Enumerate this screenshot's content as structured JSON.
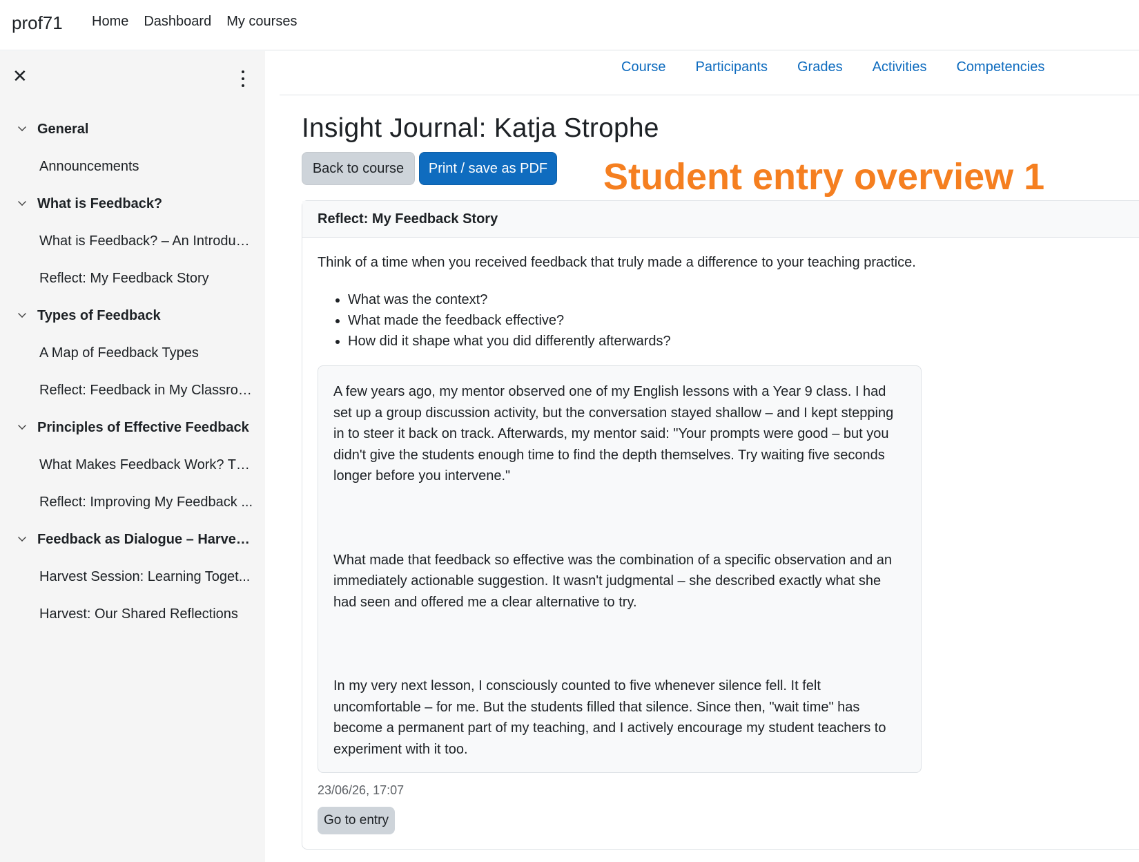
{
  "navbar": {
    "brand": "prof71",
    "links": [
      "Home",
      "Dashboard",
      "My courses"
    ]
  },
  "sidebar": {
    "close_icon": "close-icon",
    "menu_icon": "kebab-menu-icon",
    "items": [
      {
        "type": "section",
        "label": "General"
      },
      {
        "type": "activity",
        "label": "Announcements"
      },
      {
        "type": "section",
        "label": "What is Feedback?"
      },
      {
        "type": "activity",
        "label": "What is Feedback? – An Introduc..."
      },
      {
        "type": "activity",
        "label": "Reflect: My Feedback Story"
      },
      {
        "type": "section",
        "label": "Types of Feedback"
      },
      {
        "type": "activity",
        "label": "A Map of Feedback Types"
      },
      {
        "type": "activity",
        "label": "Reflect: Feedback in My Classroo..."
      },
      {
        "type": "section",
        "label": "Principles of Effective Feedback"
      },
      {
        "type": "activity",
        "label": "What Makes Feedback Work? Th..."
      },
      {
        "type": "activity",
        "label": "Reflect: Improving My Feedback ..."
      },
      {
        "type": "section",
        "label": "Feedback as Dialogue – Harves..."
      },
      {
        "type": "activity",
        "label": "Harvest Session: Learning Toget..."
      },
      {
        "type": "activity",
        "label": "Harvest: Our Shared Reflections"
      }
    ]
  },
  "secondary_nav": {
    "links": [
      "Course",
      "Participants",
      "Grades",
      "Activities",
      "Competencies"
    ]
  },
  "main": {
    "title": "Insight Journal: Katja Strophe",
    "back_button": "Back to course",
    "print_button": "Print / save as PDF",
    "annotation": "Student entry overview 1",
    "card": {
      "header": "Reflect: My Feedback Story",
      "prompt": "Think of a time when you received feedback that truly made a difference to your teaching practice.",
      "bullets": [
        "What was the context?",
        "What made the feedback effective?",
        "How did it shape what you did differently afterwards?"
      ],
      "entry_paragraphs": [
        "A few years ago, my mentor observed one of my English lessons with a Year 9 class. I had set up a group discussion activity, but the conversation stayed shallow – and I kept stepping in to steer it back on track. Afterwards, my mentor said: \"Your prompts were good – but you didn't give the students enough time to find the depth themselves. Try waiting five seconds longer before you intervene.\"",
        "What made that feedback so effective was the combination of a specific observation and an immediately actionable suggestion. It wasn't judgmental – she described exactly what she had seen and offered me a clear alternative to try.",
        "In my very next lesson, I consciously counted to five whenever silence fell. It felt uncomfortable – for me. But the students filled that silence. Since then, \"wait time\" has become a permanent part of my teaching, and I actively encourage my student teachers to experiment with it too."
      ],
      "timestamp": "23/06/26, 17:07",
      "goto_button": "Go to entry"
    }
  }
}
